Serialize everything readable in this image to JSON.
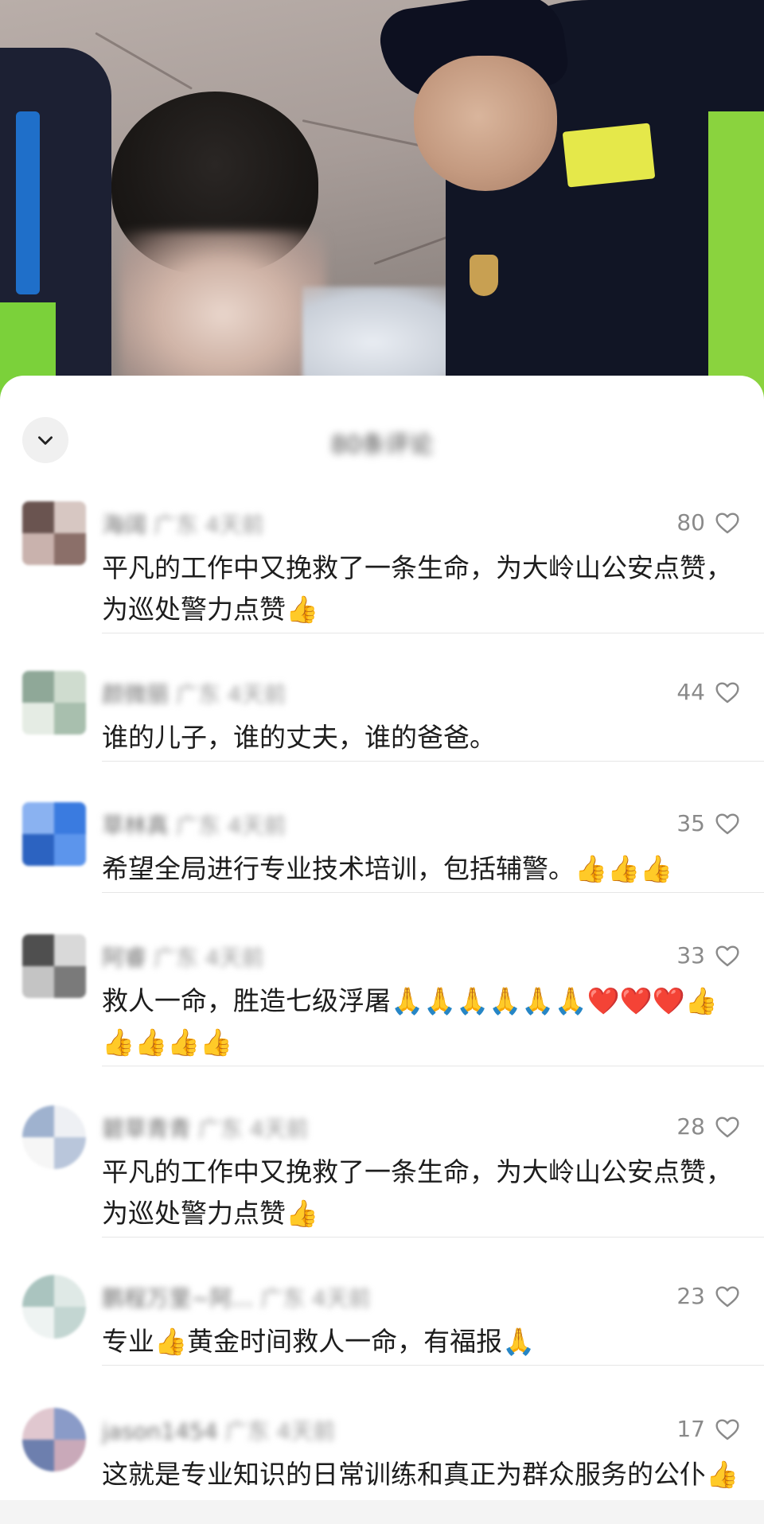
{
  "sheet": {
    "title": "80条评论"
  },
  "comments": [
    {
      "user": "海阔",
      "location": "广东",
      "time": "4天前",
      "text": "平凡的工作中又挽救了一条生命，为大岭山公安点赞，为巡处警力点赞👍",
      "likes": "80",
      "avatar_colors": [
        "#d7c7c2",
        "#8b6f69",
        "#c9b2ad",
        "#6a5450"
      ]
    },
    {
      "user": "颜微丽",
      "location": "广东",
      "time": "4天前",
      "text": "谁的儿子，谁的丈夫，谁的爸爸。",
      "likes": "44",
      "avatar_colors": [
        "#cfdccf",
        "#a8bfae",
        "#e5ece4",
        "#8fa898"
      ]
    },
    {
      "user": "草林真",
      "location": "广东",
      "time": "4天前",
      "text": "希望全局进行专业技术培训，包括辅警。👍👍👍",
      "likes": "35",
      "avatar_colors": [
        "#3a7be0",
        "#5c95ec",
        "#2c63c1",
        "#8ab2f1"
      ]
    },
    {
      "user": "阿睿",
      "location": "广东",
      "time": "4天前",
      "text": "救人一命，胜造七级浮屠🙏🙏🙏🙏🙏🙏❤️❤️❤️👍👍👍👍👍",
      "likes": "33",
      "avatar_colors": [
        "#d9d9d9",
        "#7a7a7a",
        "#c4c4c4",
        "#4f4f4f"
      ]
    },
    {
      "user": "碧草青青",
      "location": "广东",
      "time": "4天前",
      "text": "平凡的工作中又挽救了一条生命，为大岭山公安点赞，为巡处警力点赞👍",
      "likes": "28",
      "avatar_colors": [
        "#eef0f4",
        "#b9c6db",
        "#f6f6f6",
        "#9fb2cf"
      ]
    },
    {
      "user": "鹏程万里~阿...",
      "location": "广东",
      "time": "4天前",
      "text": "专业👍黄金时间救人一命，有福报🙏",
      "likes": "23",
      "avatar_colors": [
        "#dfe9e6",
        "#c3d6d2",
        "#eef3f2",
        "#aac4bf"
      ]
    },
    {
      "user": "jason1454",
      "location": "广东",
      "time": "4天前",
      "text": "这就是专业知识的日常训练和真正为群众服务的公仆👍🙏🙏🙏",
      "likes": "17",
      "avatar_colors": [
        "#8a9bc8",
        "#c9a9b9",
        "#6d7fae",
        "#e0c7cf"
      ]
    }
  ]
}
